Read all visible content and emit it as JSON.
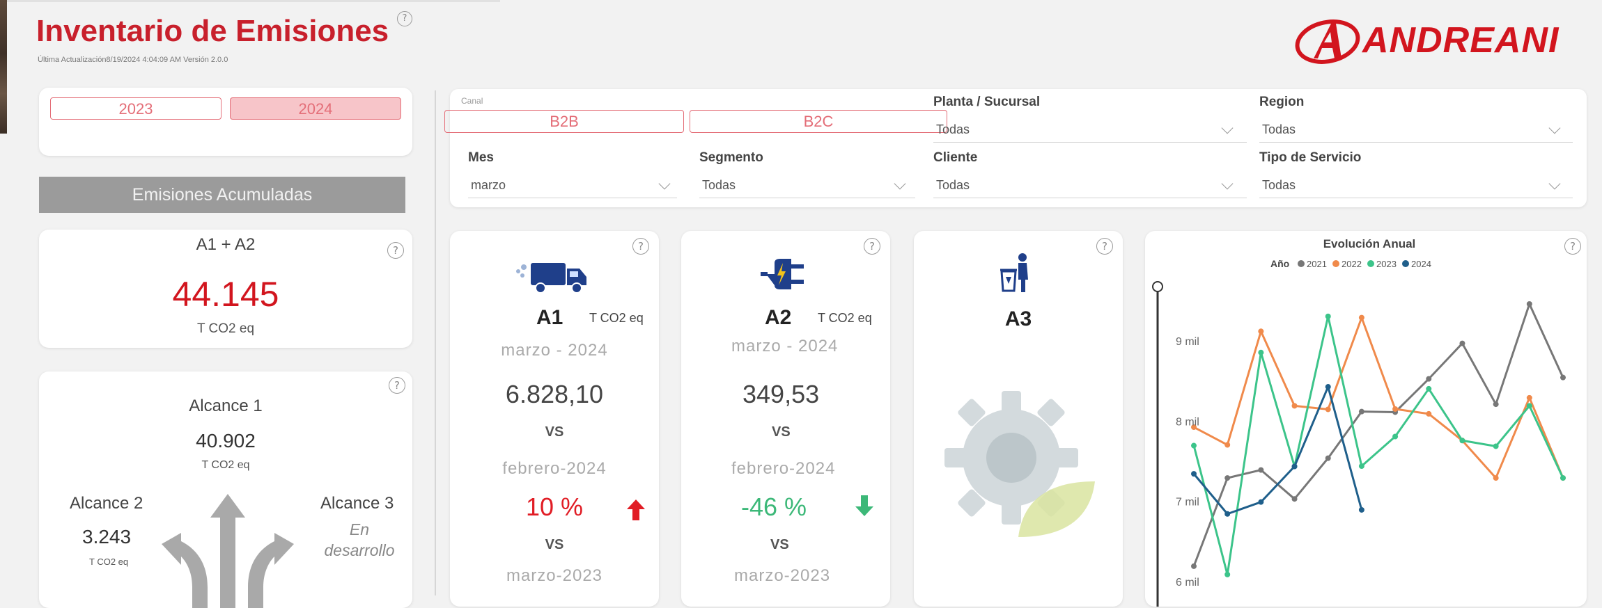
{
  "header": {
    "title": "Inventario de Emisiones",
    "subtitle": "Última Actualización8/19/2024 4:04:09 AM   Versión  2.0.0",
    "logo_text": "ANDREANI"
  },
  "year_filter": {
    "options": [
      "2023",
      "2024"
    ],
    "selected": "2024"
  },
  "banner": "Emisiones Acumuladas",
  "a1a2_card": {
    "title": "A1 + A2",
    "value": "44.145",
    "unit": "T CO2 eq"
  },
  "alcance_card": {
    "alcance1": {
      "label": "Alcance 1",
      "value": "40.902",
      "unit": "T CO2 eq"
    },
    "alcance2": {
      "label": "Alcance 2",
      "value": "3.243",
      "unit": "T CO2 eq"
    },
    "alcance3": {
      "label": "Alcance 3",
      "status": "En desarrollo"
    }
  },
  "filters": {
    "canal": {
      "label": "Canal",
      "options": [
        "B2B",
        "B2C"
      ]
    },
    "planta": {
      "label": "Planta / Sucursal",
      "value": "Todas"
    },
    "region": {
      "label": "Region",
      "value": "Todas"
    },
    "mes": {
      "label": "Mes",
      "value": "marzo"
    },
    "segmento": {
      "label": "Segmento",
      "value": "Todas"
    },
    "cliente": {
      "label": "Cliente",
      "value": "Todas"
    },
    "tipo_servicio": {
      "label": "Tipo de Servicio",
      "value": "Todas"
    }
  },
  "kpi_a1": {
    "title": "A1",
    "unit": "T CO2 eq",
    "period": "marzo - 2024",
    "value": "6.828,10",
    "vs1": "VS",
    "compare_period": "febrero-2024",
    "change": "10 %",
    "vs2": "VS",
    "compare_period2": "marzo-2023",
    "trend": "up",
    "trend_color": "#e11d25"
  },
  "kpi_a2": {
    "title": "A2",
    "unit": "T CO2 eq",
    "period": "marzo - 2024",
    "value": "349,53",
    "vs1": "VS",
    "compare_period": "febrero-2024",
    "change": "-46 %",
    "vs2": "VS",
    "compare_period2": "marzo-2023",
    "trend": "down",
    "trend_color": "#3cb878"
  },
  "kpi_a3": {
    "title": "A3"
  },
  "icons": {
    "a1": "truck-icon",
    "a2": "plug-icon",
    "a3": "recycle-bin-icon",
    "a3_graphic": "gear-leaf-icon",
    "help": "help-icon",
    "alcance": "three-arrows-icon"
  },
  "colors": {
    "brand_red": "#c8202c",
    "accent_pink": "#e46e78",
    "series_2021": "#777777",
    "series_2022": "#f08a4b",
    "series_2023": "#3cc48a",
    "series_2024": "#1f5f8b"
  },
  "chart_data": {
    "type": "line",
    "title": "Evolución Anual",
    "legend_title": "Año",
    "legend_position": "top",
    "x": [
      1,
      2,
      3,
      4,
      5,
      6,
      7,
      8,
      9,
      10,
      11,
      12
    ],
    "ylim": [
      5800,
      9600
    ],
    "yticks": [
      6000,
      7000,
      8000,
      9000
    ],
    "ytick_labels": [
      "6 mil",
      "7 mil",
      "8 mil",
      "9 mil"
    ],
    "series": [
      {
        "name": "2021",
        "color": "#777777",
        "values": [
          6200,
          7300,
          7400,
          7039,
          7547,
          8128,
          8121,
          8536,
          8979,
          8220,
          9470,
          8553
        ]
      },
      {
        "name": "2022",
        "color": "#f08a4b",
        "values": [
          7934,
          7713,
          9129,
          8200,
          8156,
          9300,
          8160,
          8100,
          7767,
          7300,
          8300,
          7300
        ]
      },
      {
        "name": "2023",
        "color": "#3cc48a",
        "values": [
          7704,
          6096,
          8865,
          7445,
          9316,
          7448,
          7817,
          8412,
          7767,
          7696,
          8200,
          7300
        ]
      },
      {
        "name": "2024",
        "color": "#1f5f8b",
        "values": [
          7352,
          6852,
          7000,
          7444,
          8437,
          6902
        ]
      }
    ]
  }
}
